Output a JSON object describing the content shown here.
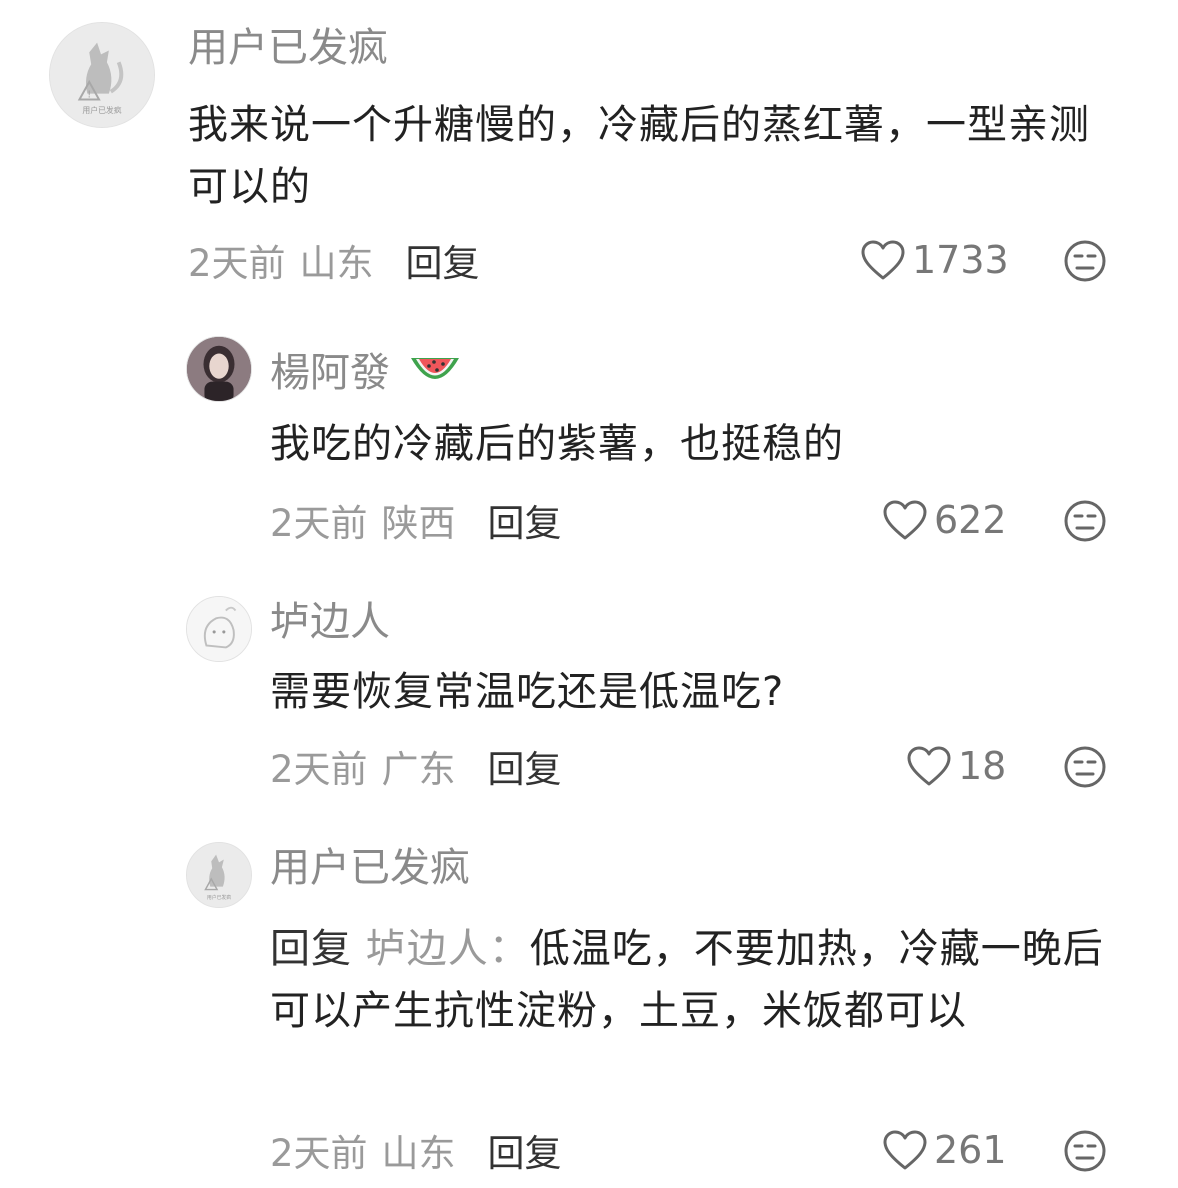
{
  "comments": [
    {
      "username": "用户已发疯",
      "avatar_label": "用户已发疯",
      "text": "我来说一个升糖慢的，冷藏后的蒸红薯，一型亲测可以的",
      "time": "2天前",
      "region": "山东",
      "reply_label": "回复",
      "likes": "1733"
    },
    {
      "username": "楊阿發",
      "username_emoji": "watermelon-icon",
      "text": "我吃的冷藏后的紫薯，也挺稳的",
      "time": "2天前",
      "region": "陕西",
      "reply_label": "回复",
      "likes": "622"
    },
    {
      "username": "垆边人",
      "text": "需要恢复常温吃还是低温吃?",
      "time": "2天前",
      "region": "广东",
      "reply_label": "回复",
      "likes": "18"
    },
    {
      "username": "用户已发疯",
      "avatar_label": "用户已发疯",
      "reply_prefix": "回复",
      "reply_target": "垆边人：",
      "text": "低温吃，不要加热，冷藏一晚后可以产生抗性淀粉，土豆，米饭都可以",
      "time": "2天前",
      "region": "山东",
      "reply_label": "回复",
      "likes": "261"
    }
  ],
  "icons": {
    "like": "heart-outline-icon",
    "dislike": "meh-face-icon"
  },
  "colors": {
    "username": "#8a8a8a",
    "text": "#222222",
    "meta": "#9a9a9a",
    "watermelon_rind": "#3fa34d",
    "watermelon_flesh": "#f0565b"
  }
}
